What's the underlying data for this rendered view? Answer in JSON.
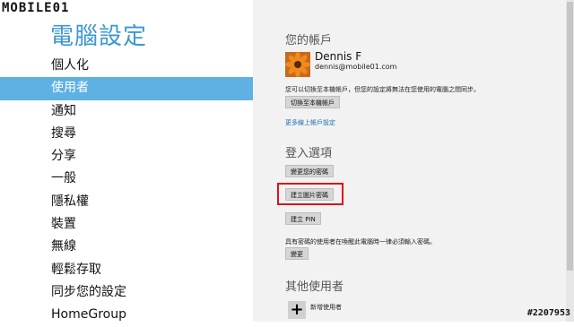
{
  "watermark": "MOBILE01",
  "page_title": "電腦設定",
  "nav": {
    "items": [
      {
        "label": "個人化"
      },
      {
        "label": "使用者",
        "active": true
      },
      {
        "label": "通知"
      },
      {
        "label": "搜尋"
      },
      {
        "label": "分享"
      },
      {
        "label": "一般"
      },
      {
        "label": "隱私權"
      },
      {
        "label": "裝置"
      },
      {
        "label": "無線"
      },
      {
        "label": "輕鬆存取"
      },
      {
        "label": "同步您的設定"
      },
      {
        "label": "HomeGroup"
      }
    ]
  },
  "account": {
    "section_title": "您的帳戶",
    "name": "Dennis F",
    "email": "dennis@mobile01.com",
    "description": "您可以切換至本機帳戶，但您的設定將無法在您使用的電腦之間同步。",
    "switch_button": "切換至本機帳戶",
    "more_link": "更多線上帳戶設定"
  },
  "signin": {
    "section_title": "登入選項",
    "change_password_button": "變更您的密碼",
    "picture_password_button": "建立圖片密碼",
    "pin_button": "建立 PIN",
    "policy_text": "具有密碼的使用者在喚醒此電腦時一律必須輸入密碼。",
    "change_button": "變更"
  },
  "other_users": {
    "section_title": "其他使用者",
    "add_label": "新增使用者"
  },
  "image_id": "#2207953"
}
